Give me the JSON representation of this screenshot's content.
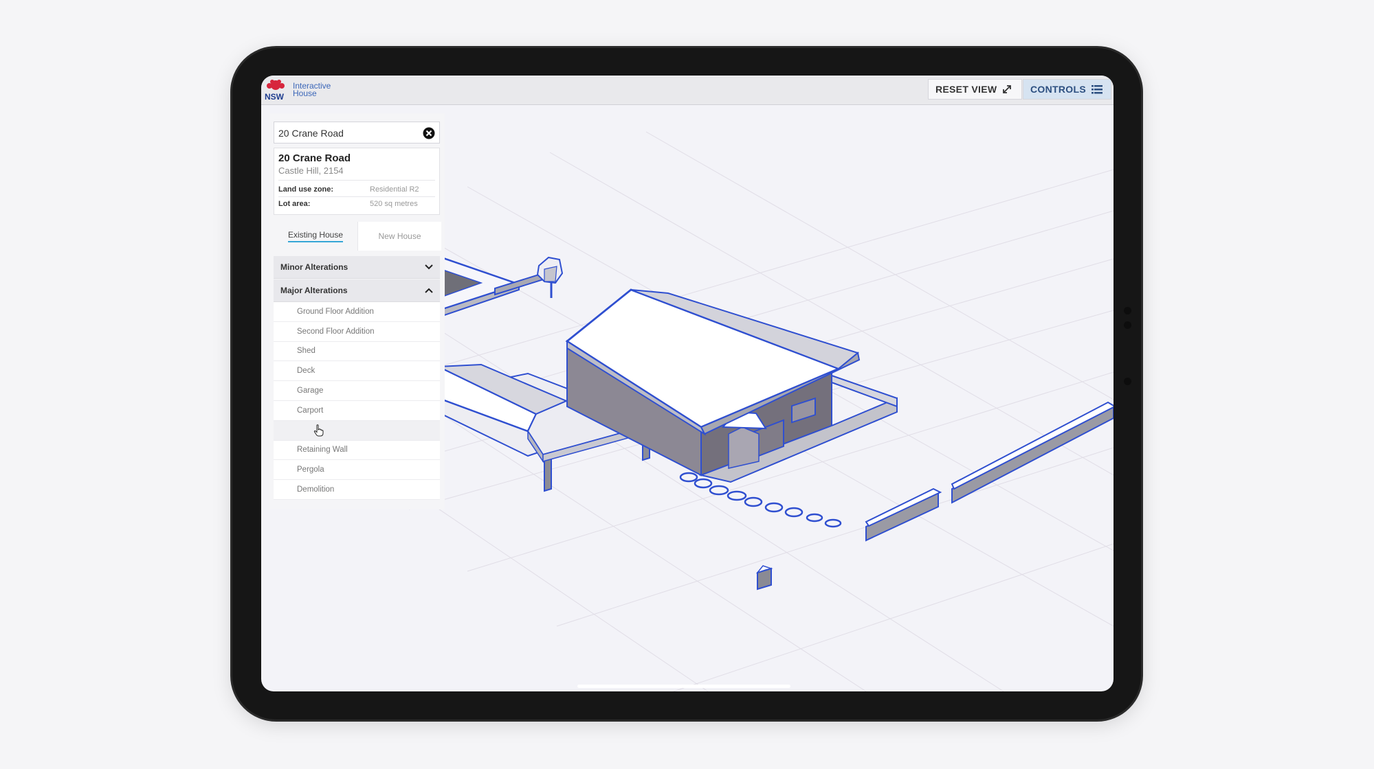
{
  "app": {
    "logo_text": "NSW",
    "name_line1": "Interactive",
    "name_line2": "House"
  },
  "toolbar": {
    "reset_label": "RESET VIEW",
    "controls_label": "CONTROLS"
  },
  "search": {
    "value": "20 Crane Road"
  },
  "property": {
    "title": "20 Crane Road",
    "suburb": "Castle Hill, 2154",
    "zone_label": "Land use zone:",
    "zone_value": "Residential R2",
    "lot_label": "Lot area:",
    "lot_value": "520 sq metres"
  },
  "tabs": [
    {
      "label": "Existing House",
      "active": true
    },
    {
      "label": "New House",
      "active": false
    }
  ],
  "sections": {
    "minor": "Minor Alterations",
    "major": "Major Alterations"
  },
  "major_items": [
    "Ground Floor Addition",
    "Second Floor Addition",
    "Shed",
    "Deck",
    "Garage",
    "Carport",
    "",
    "Retaining Wall",
    "Pergola",
    "Demolition"
  ],
  "colors": {
    "accent": "#2f4fd0",
    "tab_underline": "#35a6d6",
    "controls_bg": "#d6e3f1"
  },
  "icons": {
    "reset": "expand-arrows-icon",
    "controls": "list-icon",
    "clear": "close-circle-icon",
    "expand": "chevron-down-icon",
    "collapse": "chevron-up-icon",
    "cursor": "hand-pointer-icon"
  }
}
